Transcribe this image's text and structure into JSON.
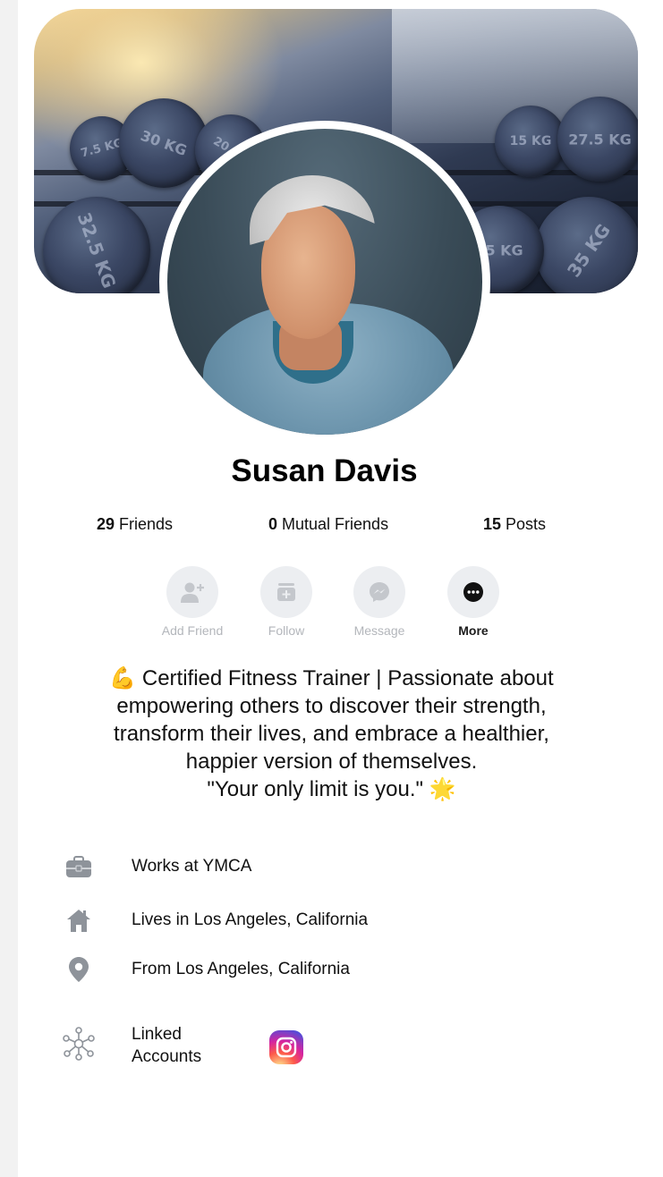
{
  "profile": {
    "name": "Susan Davis",
    "stats": [
      {
        "count": "29",
        "label": " Friends"
      },
      {
        "count": "0",
        "label": " Mutual Friends"
      },
      {
        "count": "15",
        "label": " Posts"
      }
    ]
  },
  "actions": [
    {
      "label": "Add Friend",
      "icon": "add-friend-icon"
    },
    {
      "label": "Follow",
      "icon": "follow-icon"
    },
    {
      "label": "Message",
      "icon": "messenger-icon"
    },
    {
      "label": "More",
      "icon": "more-icon"
    }
  ],
  "bio": {
    "lines": [
      "💪 Certified Fitness Trainer | Passionate about",
      "empowering others to discover their strength,",
      "transform their lives, and embrace a healthier,",
      "happier version of themselves.",
      "\"Your only limit is you.\" 🌟"
    ]
  },
  "about": {
    "work": "Works at YMCA",
    "lives": "Lives in Los Angeles, California",
    "from": "From Los Angeles, California",
    "linked_line1": "Linked",
    "linked_line2": "Accounts"
  },
  "cover": {
    "plates": [
      "7.5 KG",
      "30 KG",
      "20 KG",
      "15 KG",
      "27.5 KG",
      "32.5 KG",
      "35 KG",
      "25 KG"
    ]
  },
  "colors": {
    "instagram": "#d6249f",
    "icon_gray": "#8e939a",
    "disabled_label": "#b3b6bb"
  }
}
